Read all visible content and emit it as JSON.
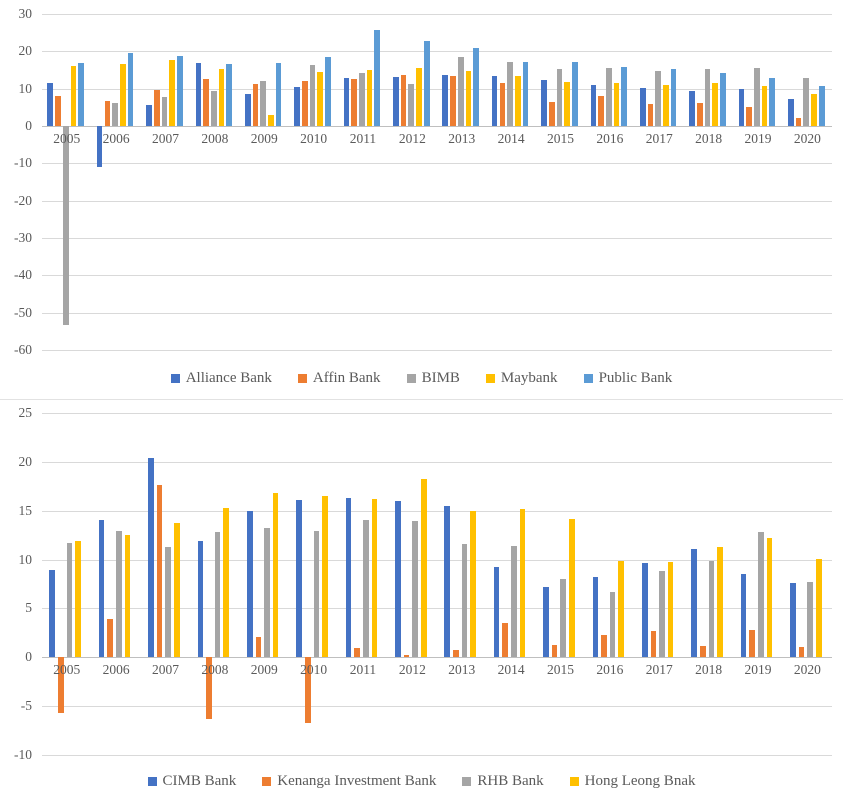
{
  "charts": [
    {
      "id": "top",
      "legend": [
        {
          "label": "Alliance Bank",
          "color": "#4472C4"
        },
        {
          "label": "Affin Bank",
          "color": "#ED7D31"
        },
        {
          "label": "BIMB",
          "color": "#A5A5A5"
        },
        {
          "label": "Maybank",
          "color": "#FFC000"
        },
        {
          "label": "Public Bank",
          "color": "#5B9BD5"
        }
      ]
    },
    {
      "id": "bottom",
      "legend": [
        {
          "label": "CIMB Bank",
          "color": "#4472C4"
        },
        {
          "label": "Kenanga Investment Bank",
          "color": "#ED7D31"
        },
        {
          "label": "RHB Bank",
          "color": "#A5A5A5"
        },
        {
          "label": "Hong Leong Bnak",
          "color": "#FFC000"
        }
      ]
    }
  ],
  "chart_data": [
    {
      "type": "bar",
      "title": "",
      "xlabel": "",
      "ylabel": "",
      "grid": true,
      "legend_position": "bottom",
      "ylim": [
        -60,
        30
      ],
      "yticks": [
        30,
        20,
        10,
        0,
        -10,
        -20,
        -30,
        -40,
        -50,
        -60
      ],
      "ytick_labels": [
        "30",
        "20",
        "10",
        "0",
        "-10",
        "-20",
        "-30",
        "-40",
        "-50",
        "-60"
      ],
      "categories": [
        "2005",
        "2006",
        "2007",
        "2008",
        "2009",
        "2010",
        "2011",
        "2012",
        "2013",
        "2014",
        "2015",
        "2016",
        "2017",
        "2018",
        "2019",
        "2020"
      ],
      "series": [
        {
          "name": "Alliance Bank",
          "color": "#4472C4",
          "values": [
            11.4,
            -10.9,
            5.6,
            16.8,
            8.6,
            10.4,
            12.8,
            13.1,
            13.7,
            13.4,
            12.3,
            11.0,
            10.2,
            9.4,
            9.9,
            7.3
          ]
        },
        {
          "name": "Affin Bank",
          "color": "#ED7D31",
          "values": [
            8.1,
            6.8,
            9.6,
            12.6,
            11.2,
            12.1,
            12.6,
            13.6,
            13.5,
            11.4,
            6.4,
            8.0,
            5.8,
            6.2,
            5.1,
            2.1
          ]
        },
        {
          "name": "BIMB",
          "color": "#A5A5A5",
          "values": [
            -53.2,
            6.2,
            7.7,
            9.3,
            12.0,
            16.3,
            14.2,
            11.2,
            18.5,
            17.1,
            15.4,
            15.6,
            14.8,
            15.2,
            15.6,
            12.8
          ]
        },
        {
          "name": "Maybank",
          "color": "#FFC000",
          "values": [
            16.0,
            16.5,
            17.6,
            15.2,
            3.0,
            14.4,
            15.0,
            15.5,
            14.7,
            13.3,
            11.8,
            11.4,
            11.1,
            11.4,
            10.7,
            8.5
          ]
        },
        {
          "name": "Public Bank",
          "color": "#5B9BD5",
          "values": [
            17.0,
            19.5,
            18.7,
            16.5,
            16.8,
            18.4,
            25.6,
            22.7,
            21.0,
            17.2,
            17.1,
            15.8,
            15.2,
            14.2,
            12.8,
            10.7
          ]
        }
      ]
    },
    {
      "type": "bar",
      "title": "",
      "xlabel": "",
      "ylabel": "",
      "grid": true,
      "legend_position": "bottom",
      "ylim": [
        -10,
        25
      ],
      "yticks": [
        25,
        20,
        15,
        10,
        5,
        0,
        -5,
        -10
      ],
      "ytick_labels": [
        "25",
        "20",
        "15",
        "10",
        "5",
        "0",
        "-5",
        "-10"
      ],
      "categories": [
        "2005",
        "2006",
        "2007",
        "2008",
        "2009",
        "2010",
        "2011",
        "2012",
        "2013",
        "2014",
        "2015",
        "2016",
        "2017",
        "2018",
        "2019",
        "2020"
      ],
      "series": [
        {
          "name": "CIMB Bank",
          "color": "#4472C4",
          "values": [
            8.9,
            14.0,
            20.4,
            11.9,
            15.0,
            16.1,
            16.3,
            16.0,
            15.5,
            9.2,
            7.2,
            8.2,
            9.6,
            11.1,
            8.5,
            7.6
          ]
        },
        {
          "name": "Kenanga Investment Bank",
          "color": "#ED7D31",
          "values": [
            -5.7,
            3.9,
            17.6,
            -6.3,
            2.1,
            -6.7,
            1.0,
            0.2,
            0.7,
            3.5,
            1.3,
            2.3,
            2.7,
            1.2,
            2.8,
            1.1
          ]
        },
        {
          "name": "RHB Bank",
          "color": "#A5A5A5",
          "values": [
            11.7,
            12.9,
            11.3,
            12.8,
            13.2,
            12.9,
            14.0,
            13.9,
            11.6,
            11.4,
            8.0,
            6.7,
            8.8,
            9.9,
            12.8,
            7.7
          ]
        },
        {
          "name": "Hong Leong Bnak",
          "color": "#FFC000",
          "values": [
            11.9,
            12.5,
            13.7,
            15.3,
            16.8,
            16.5,
            16.2,
            18.2,
            15.0,
            15.2,
            14.2,
            9.9,
            9.8,
            11.3,
            12.2,
            10.1
          ]
        }
      ]
    }
  ]
}
